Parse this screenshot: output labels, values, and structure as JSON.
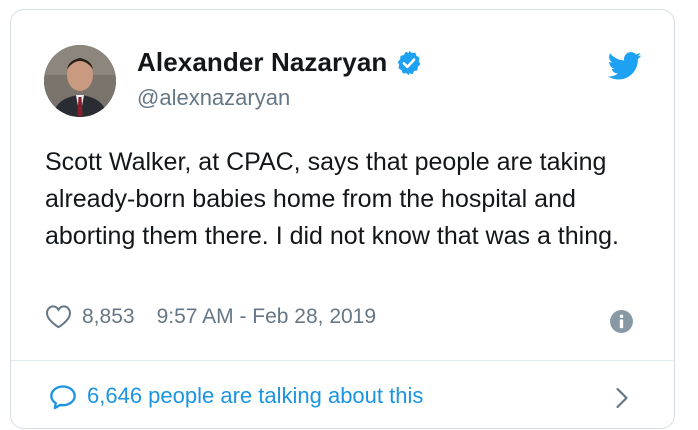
{
  "author": {
    "name": "Alexander Nazaryan",
    "handle": "@alexnazaryan"
  },
  "icons": {
    "verified": "verified-badge-icon",
    "platform": "twitter-bird-icon",
    "like": "heart-icon",
    "info": "info-icon",
    "conversation": "speech-bubble-icon",
    "expand": "chevron-right-icon"
  },
  "tweet": {
    "text": "Scott Walker, at CPAC, says that people are taking already-born babies home from the hospital and aborting them there. I did not know that was a thing.",
    "likes": "8,853",
    "timestamp": "9:57 AM - Feb 28, 2019"
  },
  "footer": {
    "talking_label": "6,646 people are talking about this"
  },
  "colors": {
    "twitter_blue": "#1da1f2",
    "link_blue": "#1b95e0",
    "secondary_text": "#657786",
    "border": "#d6dde3"
  }
}
